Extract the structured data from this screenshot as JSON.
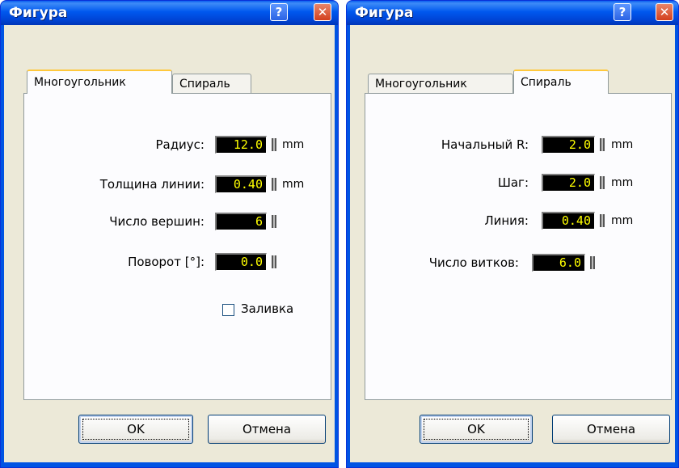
{
  "left_dialog": {
    "title": "Фигура",
    "help_glyph": "?",
    "close_glyph": "✕",
    "tabs": [
      {
        "label": "Многоугольник",
        "active": true
      },
      {
        "label": "Спираль",
        "active": false
      }
    ],
    "fields": {
      "radius": {
        "label": "Радиус:",
        "value": "12.0",
        "unit": "mm"
      },
      "line_width": {
        "label": "Толщина линии:",
        "value": "0.40",
        "unit": "mm"
      },
      "vertices": {
        "label": "Число вершин:",
        "value": "6"
      },
      "rotation": {
        "label": "Поворот [°]:",
        "value": "0.0"
      }
    },
    "fill_checkbox": {
      "label": "Заливка",
      "checked": false
    },
    "ok_label": "OK",
    "cancel_label": "Отмена"
  },
  "right_dialog": {
    "title": "Фигура",
    "help_glyph": "?",
    "close_glyph": "✕",
    "tabs": [
      {
        "label": "Многоугольник",
        "active": false
      },
      {
        "label": "Спираль",
        "active": true
      }
    ],
    "fields": {
      "start_r": {
        "label": "Начальный R:",
        "value": "2.0",
        "unit": "mm"
      },
      "step": {
        "label": "Шаг:",
        "value": "2.0",
        "unit": "mm"
      },
      "line": {
        "label": "Линия:",
        "value": "0.40",
        "unit": "mm"
      },
      "turns": {
        "label": "Число витков:",
        "value": "6.0"
      }
    },
    "ok_label": "OK",
    "cancel_label": "Отмена"
  },
  "colors": {
    "title_bar": "#0054e3",
    "field_bg": "#000000",
    "field_text": "#ffff00",
    "dialog_bg": "#ece9d8",
    "close_button": "#d3401e",
    "active_tab_highlight": "#ffc83c"
  }
}
